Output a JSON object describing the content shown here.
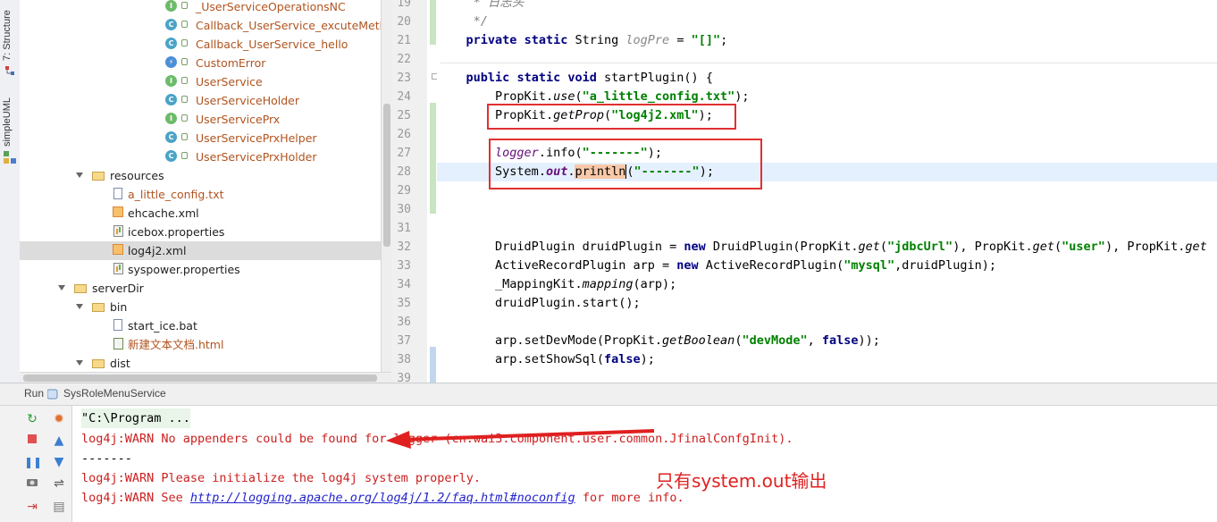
{
  "sidebar": {
    "tab_structure": "7: Structure",
    "tab_simpleuml": "simpleUML"
  },
  "tree": {
    "items": [
      {
        "label": "_UserServiceOperationsNC",
        "icon": "interface-icon"
      },
      {
        "label": "Callback_UserService_excuteMethod",
        "icon": "class-icon"
      },
      {
        "label": "Callback_UserService_hello",
        "icon": "class-icon"
      },
      {
        "label": "CustomError",
        "icon": "exception-icon"
      },
      {
        "label": "UserService",
        "icon": "interface-icon"
      },
      {
        "label": "UserServiceHolder",
        "icon": "class-icon"
      },
      {
        "label": "UserServicePrx",
        "icon": "interface-icon"
      },
      {
        "label": "UserServicePrxHelper",
        "icon": "class-icon"
      },
      {
        "label": "UserServicePrxHolder",
        "icon": "class-icon"
      },
      {
        "label": "resources",
        "icon": "folder-icon"
      },
      {
        "label": "a_little_config.txt",
        "icon": "text-file-icon"
      },
      {
        "label": "ehcache.xml",
        "icon": "xml-file-icon"
      },
      {
        "label": "icebox.properties",
        "icon": "properties-file-icon"
      },
      {
        "label": "log4j2.xml",
        "icon": "xml-file-icon"
      },
      {
        "label": "syspower.properties",
        "icon": "properties-file-icon"
      },
      {
        "label": "serverDir",
        "icon": "folder-icon"
      },
      {
        "label": "bin",
        "icon": "folder-icon"
      },
      {
        "label": "start_ice.bat",
        "icon": "text-file-icon"
      },
      {
        "label": "新建文本文档.html",
        "icon": "html-file-icon"
      },
      {
        "label": "dist",
        "icon": "folder-icon"
      }
    ]
  },
  "editor": {
    "line_numbers": [
      "19",
      "20",
      "21",
      "22",
      "23",
      "24",
      "25",
      "26",
      "27",
      "28",
      "29",
      "30",
      "31",
      "32",
      "33",
      "34",
      "35",
      "36",
      "37",
      "38",
      "39"
    ],
    "l19_comment": "* 日志头",
    "l20_comment": "*/",
    "kw_private": "private",
    "kw_static": "static",
    "kw_public": "public",
    "kw_void": "void",
    "kw_new": "new",
    "kw_false": "false",
    "t_String": "String",
    "v_logPre": "logPre",
    "s_brackets": "\"[]\"",
    "m_startPlugin": "startPlugin()",
    "c_PropKit": "PropKit",
    "m_use": "use",
    "s_config": "\"a_little_config.txt\"",
    "m_getProp": "getProp",
    "s_log4j2": "\"log4j2.xml\"",
    "f_logger": "logger",
    "m_info": "info",
    "s_dashes": "\"-------\"",
    "c_System": "System",
    "f_out": "out",
    "m_println": "println",
    "c_DruidPlugin": "DruidPlugin",
    "v_druidPlugin": "druidPlugin",
    "m_get": "get",
    "s_jdbcUrl": "\"jdbcUrl\"",
    "s_user": "\"user\"",
    "c_ActiveRecordPlugin": "ActiveRecordPlugin",
    "v_arp": "arp",
    "s_mysql": "\"mysql\"",
    "c_MappingKit": "_MappingKit",
    "m_mapping": "mapping",
    "m_start": "start",
    "m_setDevMode": "setDevMode",
    "m_getBoolean": "getBoolean",
    "s_devMode": "\"devMode\"",
    "m_setShowSql": "setShowSql"
  },
  "run": {
    "label": "Run",
    "config_name": "SysRoleMenuService"
  },
  "console": {
    "cmd": "\"C:\\Program ...",
    "warn1": "log4j:WARN No appenders could be found for logger (cn.wai3.component.user.common.JfinalConfgInit).",
    "dashes": "-------",
    "warn2": "log4j:WARN Please initialize the log4j system properly.",
    "warn3_prefix": "log4j:WARN See ",
    "warn3_link": "http://logging.apache.org/log4j/1.2/faq.html#noconfig",
    "warn3_suffix": " for more info."
  },
  "annotation": {
    "note": "只有system.out输出"
  },
  "colors": {
    "annotation_red": "#e02020",
    "keyword": "#000080",
    "string": "#008000",
    "console_warn": "#cc2020"
  }
}
